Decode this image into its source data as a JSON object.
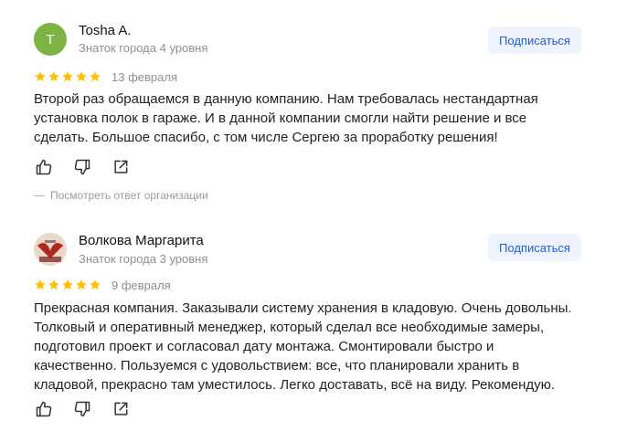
{
  "reviews": [
    {
      "author": "Tosha A.",
      "avatar_letter": "T",
      "level": "Знаток города 4 уровня",
      "subscribe_label": "Подписаться",
      "rating": 5,
      "date": "13 февраля",
      "text_lines": [
        "Второй раз обращаемся в данную компанию. Нам требовалась нестандартная",
        "установка полок в гараже. И в данной компании смогли найти решение и все",
        "сделать. Большое спасибо, с том числе Сергею за проработку решения!"
      ],
      "org_reply_label": "Посмотреть ответ организации"
    },
    {
      "author": "Волкова Маргарита",
      "level": "Знаток города 3 уровня",
      "subscribe_label": "Подписаться",
      "rating": 5,
      "date": "9 февраля",
      "text_lines": [
        "Прекрасная компания. Заказывали систему хранения в кладовую. Очень довольны.",
        "Толковый и оперативный менеджер, который сделал все необходимые замеры,",
        "подготовил проект и согласовал дату монтажа. Смонтировали быстро и",
        "качественно. Пользуемся с удовольствием: все, что планировали хранить в",
        "кладовой, прекрасно там уместилось. Легко доставать, всё на виду. Рекомендую."
      ]
    }
  ],
  "colors": {
    "star": "#fdbf00",
    "subscribe_bg": "#eef3fd",
    "subscribe_text": "#1f5fd8",
    "avatar_letter_bg": "#7cb342"
  },
  "icons": [
    "thumbs-up-icon",
    "thumbs-down-icon",
    "share-icon",
    "star-icon"
  ]
}
